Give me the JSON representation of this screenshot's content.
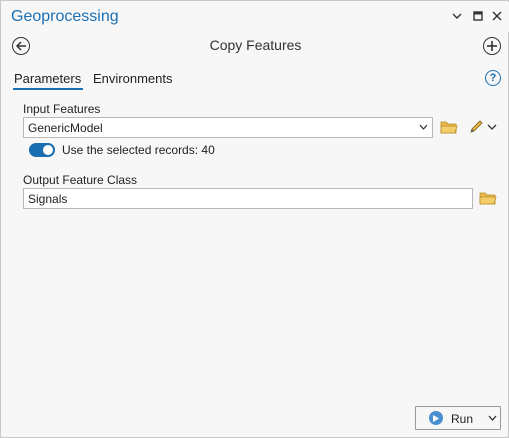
{
  "app": {
    "title": "Geoprocessing"
  },
  "window_controls": {
    "menu_icon": "chevron-down-icon",
    "maximize_icon": "maximize-icon",
    "close_icon": "close-icon"
  },
  "tool": {
    "title": "Copy Features"
  },
  "tabs": [
    {
      "label": "Parameters",
      "active": true
    },
    {
      "label": "Environments",
      "active": false
    }
  ],
  "help": {
    "symbol": "?"
  },
  "params": {
    "input_features": {
      "label": "Input Features",
      "value": "GenericModel",
      "use_selected": {
        "label": "Use the selected records: 40",
        "on": true
      }
    },
    "output_feature_class": {
      "label": "Output Feature Class",
      "value": "Signals"
    }
  },
  "run": {
    "label": "Run"
  },
  "colors": {
    "accent": "#1a6fb3",
    "folder": "#e8b84a",
    "run_play": "#4a8fcf"
  }
}
